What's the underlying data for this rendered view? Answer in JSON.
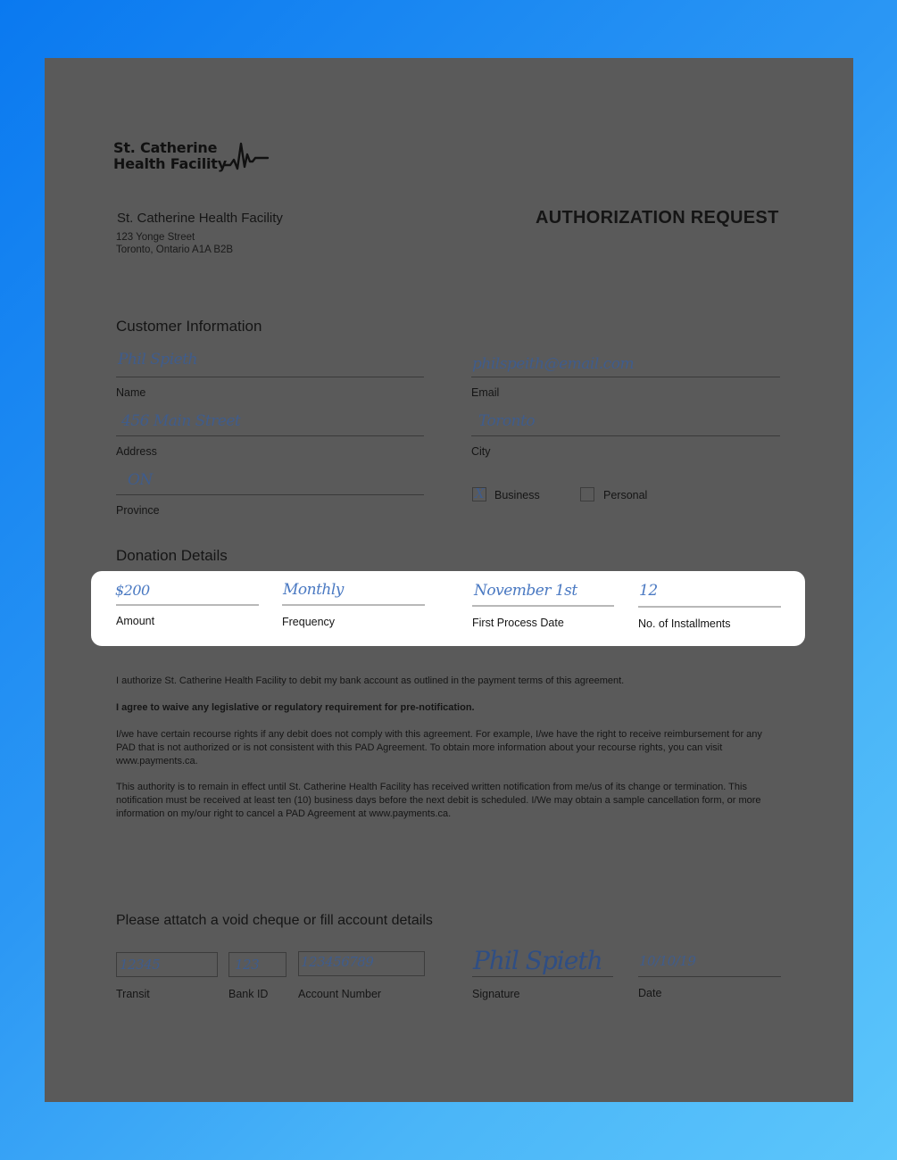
{
  "logo": {
    "line1": "St. Catherine",
    "line2": "Health Facility",
    "icon": "heartbeat-pulse-icon"
  },
  "organization": {
    "name": "St. Catherine Health Facility",
    "address_line1": "123 Yonge Street",
    "address_line2": "Toronto, Ontario A1A B2B"
  },
  "document_title": "AUTHORIZATION REQUEST",
  "customer_info": {
    "title": "Customer Information",
    "name": {
      "label": "Name",
      "value": "Phil Spieth"
    },
    "email": {
      "label": "Email",
      "value": "philspeith@email.com"
    },
    "address": {
      "label": "Address",
      "value": "456 Main Street"
    },
    "city": {
      "label": "City",
      "value": "Toronto"
    },
    "province": {
      "label": "Province",
      "value": "ON"
    },
    "account_type": {
      "business": {
        "label": "Business",
        "checked": true,
        "mark": "X"
      },
      "personal": {
        "label": "Personal",
        "checked": false,
        "mark": ""
      }
    }
  },
  "donation_details": {
    "title": "Donation Details",
    "amount": {
      "label": "Amount",
      "value": "$200"
    },
    "frequency": {
      "label": "Frequency",
      "value": "Monthly"
    },
    "first_process_date": {
      "label": "First Process Date",
      "value": "November 1st"
    },
    "installments": {
      "label": "No. of Installments",
      "value": "12"
    }
  },
  "legal": {
    "p1": "I authorize St. Catherine Health Facility to debit my bank account as outlined in the payment terms of this agreement.",
    "p2": "I agree to waive any legislative or regulatory requirement for pre-notification.",
    "p3": "I/we have certain recourse rights if any debit does not comply with this agreement. For example, I/we have the right to receive reimbursement for any PAD that is not authorized or is not consistent with this PAD Agreement. To obtain more information about your recourse rights, you can visit www.payments.ca.",
    "p4": "This authority is to remain in effect until St. Catherine Health Facility has received written notification from me/us of its change or termination. This notification must be received at least ten (10) business days before the next debit is scheduled. I/We may obtain a sample cancellation form, or more information on my/our right to cancel a PAD Agreement at www.payments.ca."
  },
  "account_details": {
    "title": "Please attatch a void cheque or fill account details",
    "transit": {
      "label": "Transit",
      "value": "12345"
    },
    "bank_id": {
      "label": "Bank ID",
      "value": "123"
    },
    "account_number": {
      "label": "Account Number",
      "value": "123456789"
    },
    "signature": {
      "label": "Signature",
      "value": "Phil Spieth"
    },
    "date": {
      "label": "Date",
      "value": "10/10/19"
    }
  }
}
